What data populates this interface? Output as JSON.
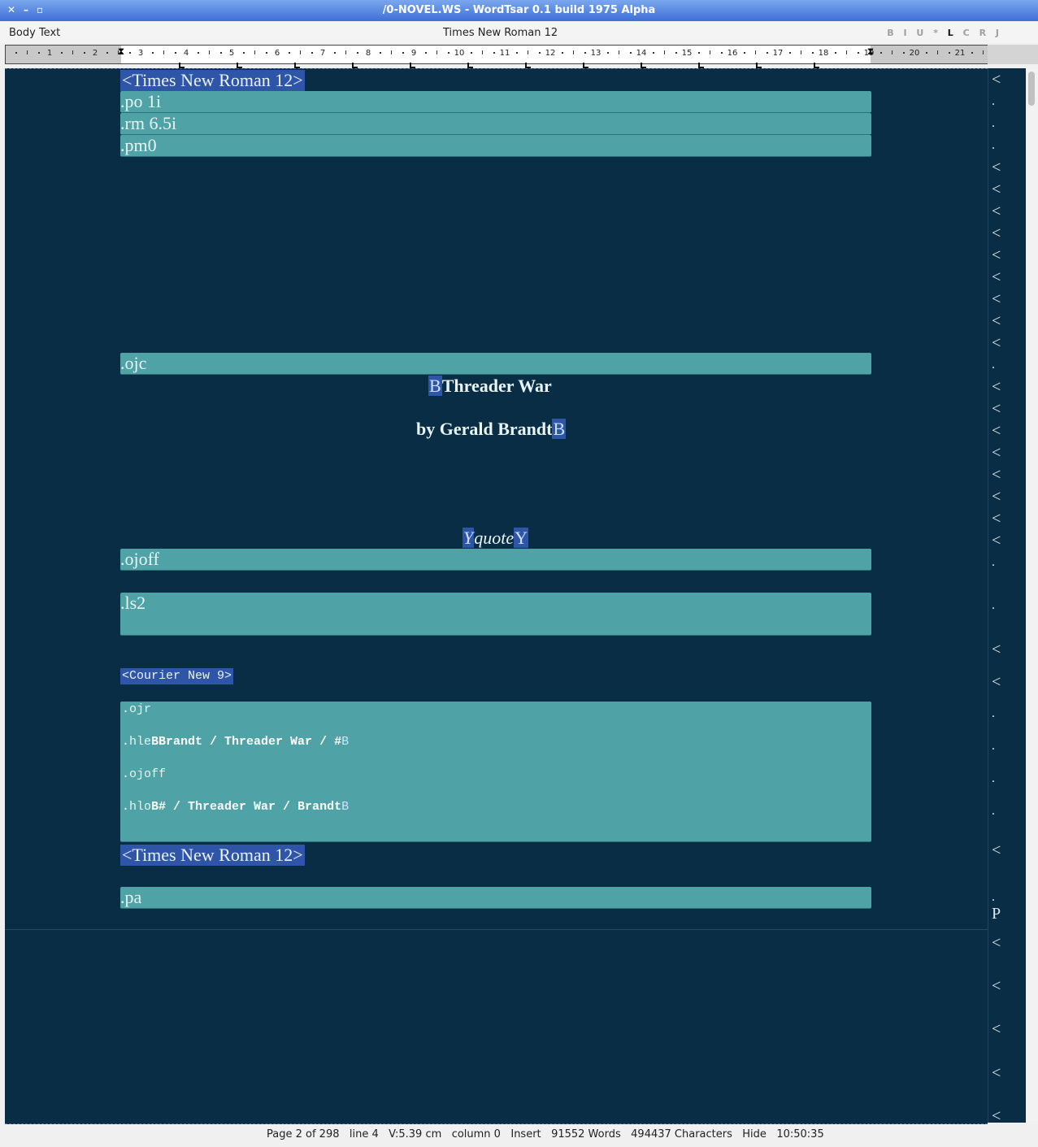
{
  "window": {
    "title": "/0-NOVEL.WS - WordTsar 0.1 build 1975 Alpha"
  },
  "infobar": {
    "style": "Body Text",
    "font": "Times New Roman 12",
    "format_buttons": [
      "B",
      "I",
      "U",
      "*",
      "L",
      "C",
      "R",
      "J"
    ],
    "active_format": "L"
  },
  "ruler": {
    "numbers": [
      "1",
      "2",
      "3",
      "4",
      "5",
      "6",
      "7",
      "8",
      "9",
      "10",
      "11",
      "12",
      "13",
      "14",
      "15",
      "16",
      "17",
      "18",
      "19",
      "20",
      "21"
    ]
  },
  "document": {
    "font_tag_top": "<Times New Roman 12>",
    "po": ".po 1i",
    "rm": ".rm 6.5i",
    "pm": ".pm0",
    "ojc": ".ojc",
    "title_marker_start": "B",
    "title_text": "Threader War",
    "byline_text": "by Gerald Brandt",
    "byline_marker_end": "B",
    "quote_marker_start": "Y",
    "quote_text": "quote",
    "quote_marker_end": "Y",
    "ojoff": ".ojoff",
    "ls2": ".ls2",
    "courier_tag": "<Courier New 9>",
    "ojr": ".ojr",
    "hle_prefix": ".hle",
    "hle_b1": "B",
    "hle_text": "Brandt / Threader War / #",
    "hle_b2": "B",
    "ojoff2": ".ojoff",
    "hlo_prefix": ".hlo",
    "hlo_b1": "B",
    "hlo_text": "# / Threader War / Brandt",
    "hlo_b2": "B",
    "font_tag_bottom": "<Times New Roman 12>",
    "pa": ".pa"
  },
  "right_column": {
    "markers": [
      "<",
      ".",
      ".",
      ".",
      "<",
      "<",
      "<",
      "<",
      "<",
      "<",
      "<",
      "<",
      "<",
      ".",
      "<",
      "<",
      "<",
      "<",
      "<",
      "<",
      "<",
      "<",
      ".",
      ".",
      "<",
      "<",
      ".",
      ".",
      ".",
      ".",
      "<",
      ".",
      "P",
      "<",
      "<",
      "<",
      "<",
      "<"
    ]
  },
  "status": {
    "page": "Page 2 of 298",
    "line": "line 4",
    "vpos": "V:5.39 cm",
    "column": "column 0",
    "mode": "Insert",
    "words": "91552 Words",
    "characters": "494437 Characters",
    "hide": "Hide",
    "time": "10:50:35"
  },
  "colors": {
    "doc_background": "#082d44",
    "dot_command_bg": "#4fa3a6",
    "tag_bg": "#2f55a8",
    "titlebar": "#3e6fd6"
  }
}
